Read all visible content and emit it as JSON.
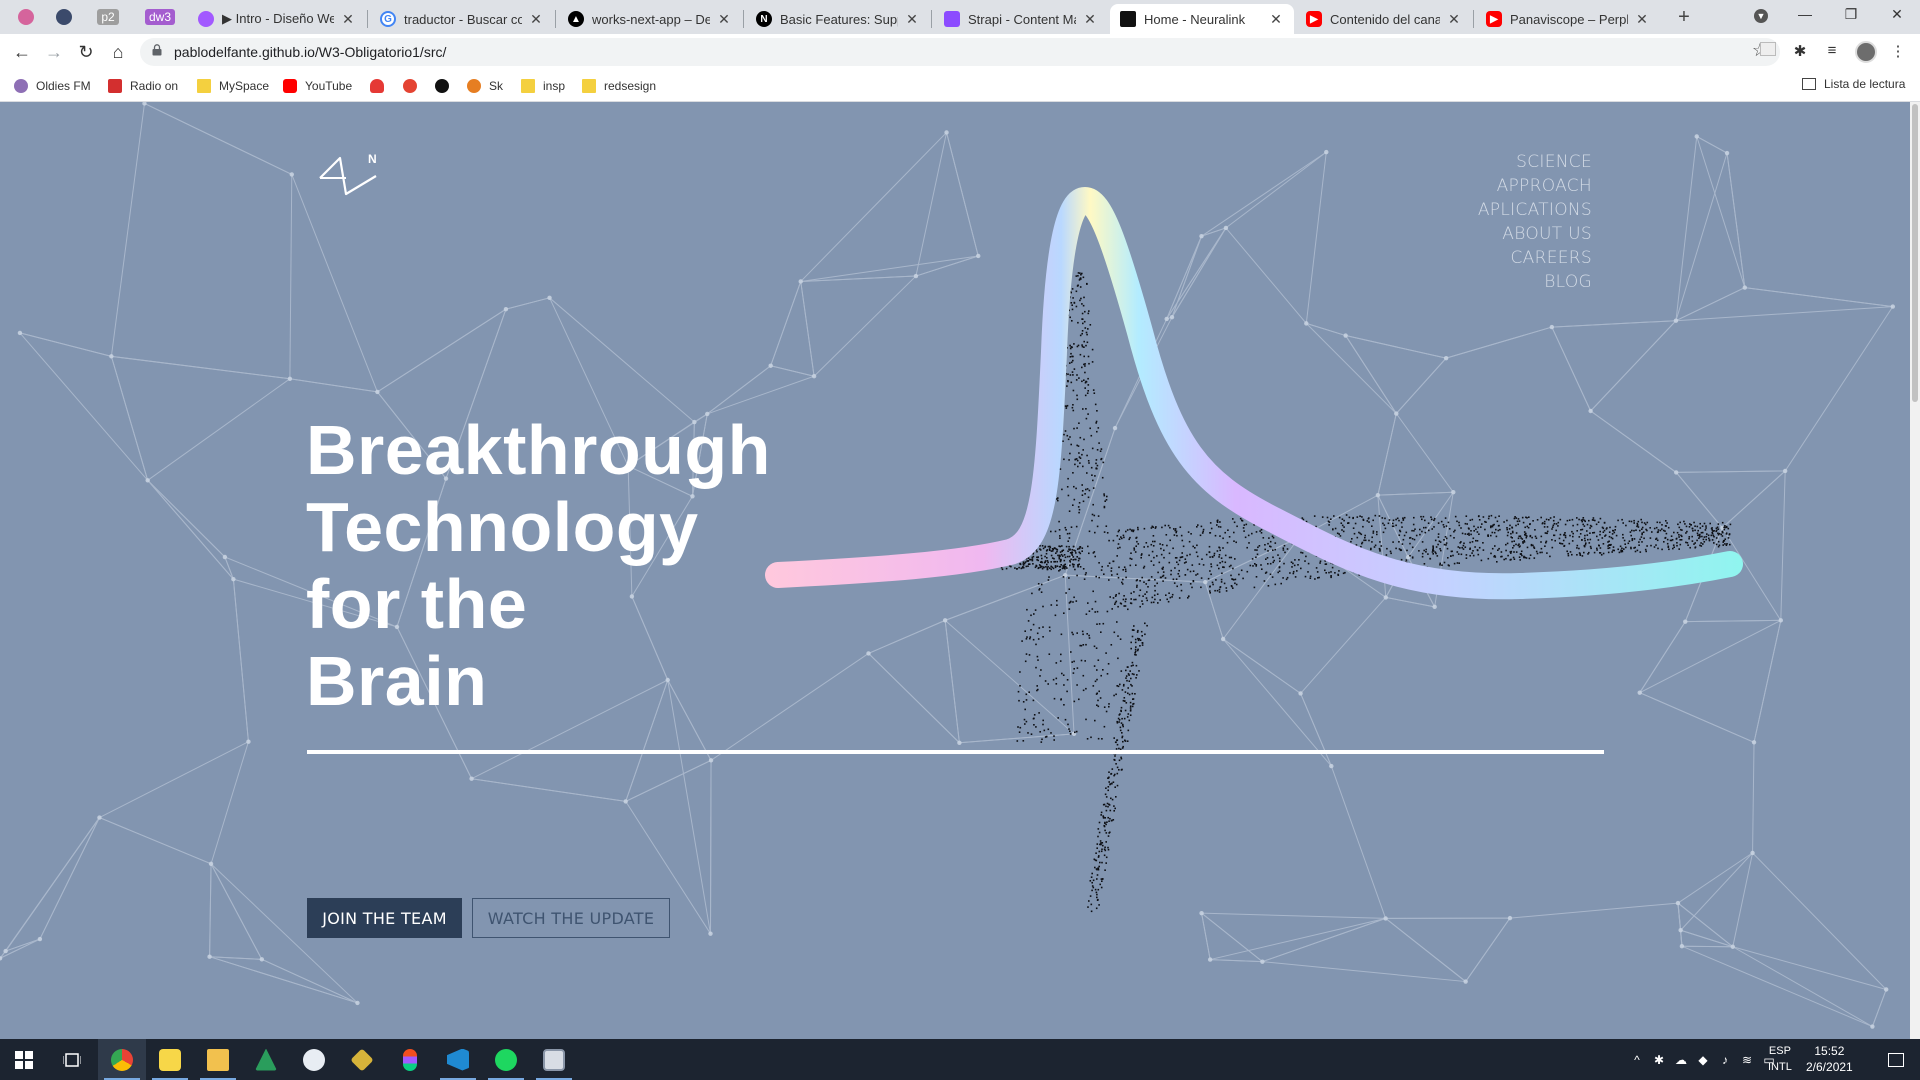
{
  "browser": {
    "pinned_tabs": [
      {
        "icon": "pink-play-icon",
        "label": ""
      },
      {
        "icon": "blue-circle-icon",
        "label": ""
      },
      {
        "icon": "badge",
        "label": "p2"
      },
      {
        "icon": "badge",
        "label": "dw3"
      }
    ],
    "tabs": [
      {
        "title": "▶ Intro - Diseño Web",
        "icon": "figma-icon",
        "color": "#a259ff"
      },
      {
        "title": "traductor - Buscar con",
        "icon": "google-icon",
        "color": "#4285f4"
      },
      {
        "title": "works-next-app – Depl",
        "icon": "vercel-icon",
        "color": "#000000"
      },
      {
        "title": "Basic Features: Suppor",
        "icon": "next-icon",
        "color": "#000000"
      },
      {
        "title": "Strapi - Content Mana",
        "icon": "strapi-icon",
        "color": "#8c4bff"
      },
      {
        "title": "Home - Neuralink",
        "icon": "neuralink-icon",
        "color": "#111111",
        "active": true
      },
      {
        "title": "Contenido del canal - Y",
        "icon": "youtube-icon",
        "color": "#ff0000"
      },
      {
        "title": "Panaviscope – Perplex",
        "icon": "youtube-icon",
        "color": "#ff0000"
      }
    ],
    "url": "pablodelfante.github.io/W3-Obligatorio1/src/",
    "bookmarks": [
      {
        "label": "Oldies FM",
        "icon": "oldies-icon",
        "color": "#8e6fb5"
      },
      {
        "label": "Radio on",
        "icon": "radio-icon",
        "color": "#d32f2f"
      },
      {
        "label": "MySpace",
        "icon": "folder-icon",
        "color": "#f4d03f"
      },
      {
        "label": "YouTube",
        "icon": "youtube-icon",
        "color": "#ff0000"
      },
      {
        "label": "",
        "icon": "huawei-icon",
        "color": "#e53935"
      },
      {
        "label": "",
        "icon": "todoist-icon",
        "color": "#e44332"
      },
      {
        "label": "",
        "icon": "notion-icon",
        "color": "#111111"
      },
      {
        "label": "Sk",
        "icon": "sk-icon",
        "color": "#e67e22"
      },
      {
        "label": "insp",
        "icon": "folder-icon",
        "color": "#f4d03f"
      },
      {
        "label": "redsesign",
        "icon": "folder-icon",
        "color": "#f4d03f"
      }
    ],
    "reading_list": "Lista de lectura"
  },
  "site": {
    "logo_letter": "N",
    "nav": [
      "SCIENCE",
      "APPROACH",
      "APLICATIONS",
      "ABOUT US",
      "CAREERS",
      "BLOG"
    ],
    "headline": [
      "Breakthrough",
      "Technology",
      "for the",
      "Brain"
    ],
    "buttons": {
      "primary": "JOIN THE TEAM",
      "secondary": "WATCH THE UPDATE"
    },
    "colors": {
      "background": "#8295b0",
      "button_dark": "#2c3e57",
      "gradient_start": "#ffb7d5",
      "gradient_mid": "#a8e6ff",
      "gradient_top": "#fffbc2",
      "gradient_end": "#8ff5f2"
    }
  },
  "taskbar": {
    "apps": [
      "windows-start-icon",
      "task-view-icon",
      "chrome-icon",
      "sticky-notes-icon",
      "file-explorer-icon",
      "sourcetree-icon",
      "steam-icon",
      "gitkraken-icon",
      "figma-icon",
      "vscode-icon",
      "spotify-icon",
      "app-icon"
    ],
    "language": [
      "ESP",
      "INTL"
    ],
    "time": "15:52",
    "date": "2/6/2021"
  }
}
